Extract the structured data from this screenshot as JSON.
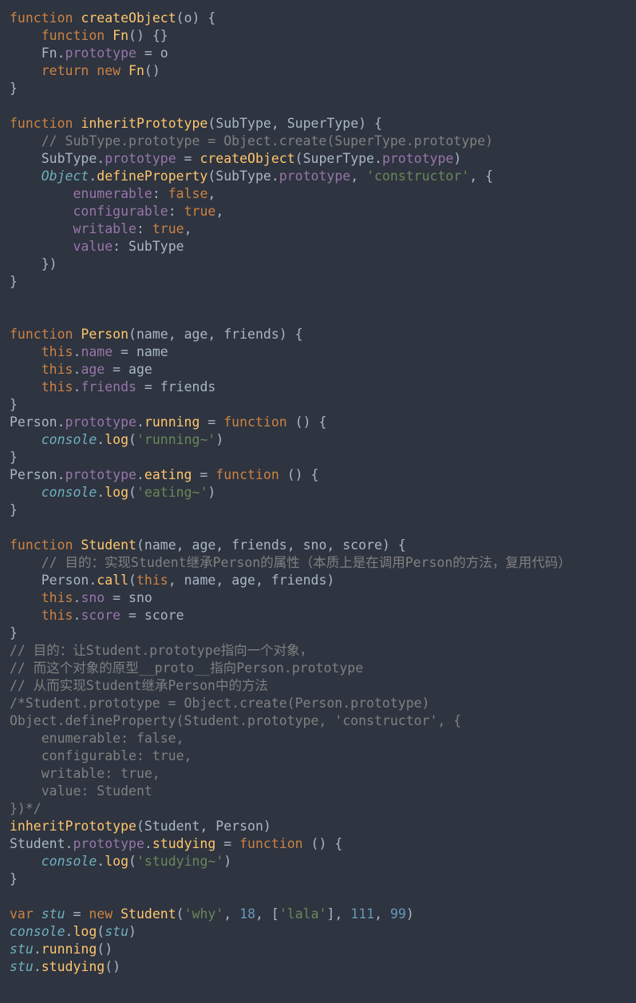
{
  "code_tokens": [
    [
      [
        "kw",
        "function"
      ],
      [
        "p",
        " "
      ],
      [
        "fn",
        "createObject"
      ],
      [
        "p",
        "("
      ],
      [
        "p",
        "o"
      ],
      [
        "p",
        ") {"
      ]
    ],
    [
      [
        "p",
        "    "
      ],
      [
        "kw",
        "function"
      ],
      [
        "p",
        " "
      ],
      [
        "fn",
        "Fn"
      ],
      [
        "p",
        "() {}"
      ]
    ],
    [
      [
        "p",
        "    Fn."
      ],
      [
        "prop",
        "prototype"
      ],
      [
        "p",
        " = o"
      ]
    ],
    [
      [
        "p",
        "    "
      ],
      [
        "kw",
        "return"
      ],
      [
        "p",
        " "
      ],
      [
        "kw",
        "new"
      ],
      [
        "p",
        " "
      ],
      [
        "fn",
        "Fn"
      ],
      [
        "p",
        "()"
      ]
    ],
    [
      [
        "p",
        "}"
      ]
    ],
    [],
    [
      [
        "kw",
        "function"
      ],
      [
        "p",
        " "
      ],
      [
        "fn",
        "inheritPrototype"
      ],
      [
        "p",
        "("
      ],
      [
        "p",
        "SubType"
      ],
      [
        "p",
        ", "
      ],
      [
        "p",
        "SuperType"
      ],
      [
        "p",
        ") {"
      ]
    ],
    [
      [
        "p",
        "    "
      ],
      [
        "cm",
        "// SubType.prototype = Object.create(SuperType.prototype)"
      ]
    ],
    [
      [
        "p",
        "    SubType."
      ],
      [
        "prop",
        "prototype"
      ],
      [
        "p",
        " = "
      ],
      [
        "fn",
        "createObject"
      ],
      [
        "p",
        "(SuperType."
      ],
      [
        "prop",
        "prototype"
      ],
      [
        "p",
        ")"
      ]
    ],
    [
      [
        "p",
        "    "
      ],
      [
        "cls",
        "Object"
      ],
      [
        "p",
        "."
      ],
      [
        "fn",
        "defineProperty"
      ],
      [
        "p",
        "(SubType."
      ],
      [
        "prop",
        "prototype"
      ],
      [
        "p",
        ", "
      ],
      [
        "str",
        "'constructor'"
      ],
      [
        "p",
        ", {"
      ]
    ],
    [
      [
        "p",
        "        "
      ],
      [
        "prop",
        "enumerable"
      ],
      [
        "p",
        ": "
      ],
      [
        "bool",
        "false"
      ],
      [
        "p",
        ","
      ]
    ],
    [
      [
        "p",
        "        "
      ],
      [
        "prop",
        "configurable"
      ],
      [
        "p",
        ": "
      ],
      [
        "bool",
        "true"
      ],
      [
        "p",
        ","
      ]
    ],
    [
      [
        "p",
        "        "
      ],
      [
        "prop",
        "writable"
      ],
      [
        "p",
        ": "
      ],
      [
        "bool",
        "true"
      ],
      [
        "p",
        ","
      ]
    ],
    [
      [
        "p",
        "        "
      ],
      [
        "prop",
        "value"
      ],
      [
        "p",
        ": SubType"
      ]
    ],
    [
      [
        "p",
        "    })"
      ]
    ],
    [
      [
        "p",
        "}"
      ]
    ],
    [],
    [],
    [
      [
        "kw",
        "function"
      ],
      [
        "p",
        " "
      ],
      [
        "fn",
        "Person"
      ],
      [
        "p",
        "(name, age, friends) {"
      ]
    ],
    [
      [
        "p",
        "    "
      ],
      [
        "this",
        "this"
      ],
      [
        "p",
        "."
      ],
      [
        "prop",
        "name"
      ],
      [
        "p",
        " = name"
      ]
    ],
    [
      [
        "p",
        "    "
      ],
      [
        "this",
        "this"
      ],
      [
        "p",
        "."
      ],
      [
        "prop",
        "age"
      ],
      [
        "p",
        " = age"
      ]
    ],
    [
      [
        "p",
        "    "
      ],
      [
        "this",
        "this"
      ],
      [
        "p",
        "."
      ],
      [
        "prop",
        "friends"
      ],
      [
        "p",
        " = friends"
      ]
    ],
    [
      [
        "p",
        "}"
      ]
    ],
    [
      [
        "p",
        "Person."
      ],
      [
        "prop",
        "prototype"
      ],
      [
        "p",
        "."
      ],
      [
        "fn",
        "running"
      ],
      [
        "p",
        " = "
      ],
      [
        "kw",
        "function"
      ],
      [
        "p",
        " () {"
      ]
    ],
    [
      [
        "p",
        "    "
      ],
      [
        "cls",
        "console"
      ],
      [
        "p",
        "."
      ],
      [
        "fn",
        "log"
      ],
      [
        "p",
        "("
      ],
      [
        "str",
        "'running~'"
      ],
      [
        "p",
        ")"
      ]
    ],
    [
      [
        "p",
        "}"
      ]
    ],
    [
      [
        "p",
        "Person."
      ],
      [
        "prop",
        "prototype"
      ],
      [
        "p",
        "."
      ],
      [
        "fn",
        "eating"
      ],
      [
        "p",
        " = "
      ],
      [
        "kw",
        "function"
      ],
      [
        "p",
        " () {"
      ]
    ],
    [
      [
        "p",
        "    "
      ],
      [
        "cls",
        "console"
      ],
      [
        "p",
        "."
      ],
      [
        "fn",
        "log"
      ],
      [
        "p",
        "("
      ],
      [
        "str",
        "'eating~'"
      ],
      [
        "p",
        ")"
      ]
    ],
    [
      [
        "p",
        "}"
      ]
    ],
    [],
    [
      [
        "kw",
        "function"
      ],
      [
        "p",
        " "
      ],
      [
        "fn",
        "Student"
      ],
      [
        "p",
        "(name, age, friends, sno, score) {"
      ]
    ],
    [
      [
        "p",
        "    "
      ],
      [
        "cm",
        "// 目的：实现Student继承Person的属性（本质上是在调用Person的方法，复用代码）"
      ]
    ],
    [
      [
        "p",
        "    Person."
      ],
      [
        "fn",
        "call"
      ],
      [
        "p",
        "("
      ],
      [
        "this",
        "this"
      ],
      [
        "p",
        ", name, age, friends)"
      ]
    ],
    [
      [
        "p",
        "    "
      ],
      [
        "this",
        "this"
      ],
      [
        "p",
        "."
      ],
      [
        "prop",
        "sno"
      ],
      [
        "p",
        " = sno"
      ]
    ],
    [
      [
        "p",
        "    "
      ],
      [
        "this",
        "this"
      ],
      [
        "p",
        "."
      ],
      [
        "prop",
        "score"
      ],
      [
        "p",
        " = score"
      ]
    ],
    [
      [
        "p",
        "}"
      ]
    ],
    [
      [
        "cm",
        "// 目的：让Student.prototype指向一个对象，"
      ]
    ],
    [
      [
        "cm",
        "// 而这个对象的原型__proto__指向Person.prototype"
      ]
    ],
    [
      [
        "cm",
        "// 从而实现Student继承Person中的方法"
      ]
    ],
    [
      [
        "cm",
        "/*Student.prototype = Object.create(Person.prototype)"
      ]
    ],
    [
      [
        "cm",
        "Object.defineProperty(Student.prototype, 'constructor', {"
      ]
    ],
    [
      [
        "cm",
        "    enumerable: false,"
      ]
    ],
    [
      [
        "cm",
        "    configurable: true,"
      ]
    ],
    [
      [
        "cm",
        "    writable: true,"
      ]
    ],
    [
      [
        "cm",
        "    value: Student"
      ]
    ],
    [
      [
        "cm",
        "})*/"
      ]
    ],
    [
      [
        "fn",
        "inheritPrototype"
      ],
      [
        "p",
        "(Student, Person)"
      ]
    ],
    [
      [
        "p",
        "Student."
      ],
      [
        "prop",
        "prototype"
      ],
      [
        "p",
        "."
      ],
      [
        "fn",
        "studying"
      ],
      [
        "p",
        " = "
      ],
      [
        "kw",
        "function"
      ],
      [
        "p",
        " () {"
      ]
    ],
    [
      [
        "p",
        "    "
      ],
      [
        "cls",
        "console"
      ],
      [
        "p",
        "."
      ],
      [
        "fn",
        "log"
      ],
      [
        "p",
        "("
      ],
      [
        "str",
        "'studying~'"
      ],
      [
        "p",
        ")"
      ]
    ],
    [
      [
        "p",
        "}"
      ]
    ],
    [],
    [
      [
        "kw",
        "var"
      ],
      [
        "p",
        " "
      ],
      [
        "id",
        "stu"
      ],
      [
        "p",
        " = "
      ],
      [
        "kw",
        "new"
      ],
      [
        "p",
        " "
      ],
      [
        "fn",
        "Student"
      ],
      [
        "p",
        "("
      ],
      [
        "str",
        "'why'"
      ],
      [
        "p",
        ", "
      ],
      [
        "num",
        "18"
      ],
      [
        "p",
        ", ["
      ],
      [
        "str",
        "'lala'"
      ],
      [
        "p",
        "], "
      ],
      [
        "num",
        "111"
      ],
      [
        "p",
        ", "
      ],
      [
        "num",
        "99"
      ],
      [
        "p",
        ")"
      ]
    ],
    [
      [
        "cls",
        "console"
      ],
      [
        "p",
        "."
      ],
      [
        "fn",
        "log"
      ],
      [
        "p",
        "("
      ],
      [
        "id",
        "stu"
      ],
      [
        "p",
        ")"
      ]
    ],
    [
      [
        "id",
        "stu"
      ],
      [
        "p",
        "."
      ],
      [
        "fn",
        "running"
      ],
      [
        "p",
        "()"
      ]
    ],
    [
      [
        "id",
        "stu"
      ],
      [
        "p",
        "."
      ],
      [
        "fn",
        "studying"
      ],
      [
        "p",
        "()"
      ]
    ]
  ]
}
